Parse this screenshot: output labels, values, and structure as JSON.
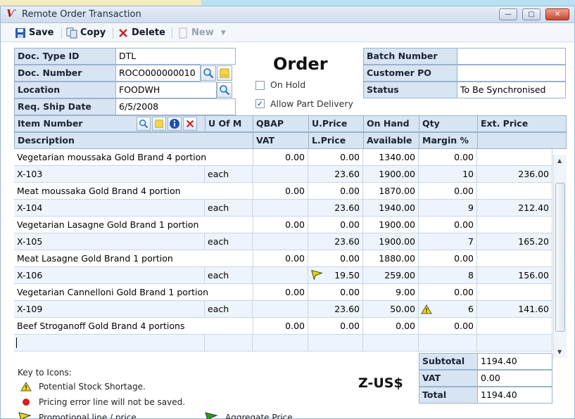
{
  "window": {
    "title": "Remote Order Transaction"
  },
  "toolbar": {
    "save": "Save",
    "copy": "Copy",
    "delete": "Delete",
    "new": "New"
  },
  "header": {
    "doc_type_id_label": "Doc. Type ID",
    "doc_type_id": "DTL",
    "doc_number_label": "Doc. Number",
    "doc_number": "ROCO000000010",
    "location_label": "Location",
    "location": "FOODWH",
    "req_ship_date_label": "Req. Ship Date",
    "req_ship_date": "6/5/2008",
    "order_title": "Order",
    "on_hold_label": "On Hold",
    "on_hold": false,
    "allow_part_label": "Allow Part Delivery",
    "allow_part": true,
    "batch_number_label": "Batch Number",
    "batch_number": "",
    "customer_po_label": "Customer PO",
    "customer_po": "",
    "status_label": "Status",
    "status": "To Be Synchronised"
  },
  "grid": {
    "head1": {
      "item_number": "Item Number",
      "uofm": "U Of M",
      "qbap": "QBAP",
      "uprice": "U.Price",
      "onhand": "On Hand",
      "qty": "Qty",
      "ext": "Ext. Price"
    },
    "head2": {
      "description": "Description",
      "vat": "VAT",
      "lprice": "L.Price",
      "available": "Available",
      "margin": "Margin %"
    },
    "items": [
      {
        "description": "Vegetarian moussaka  Gold Brand 4 portion",
        "qbap": "0.00",
        "uprice": "0.00",
        "onhand": "1340.00",
        "margin": "0.00",
        "item_number": "X-103",
        "uofm": "each",
        "lprice": "23.60",
        "available": "1900.00",
        "qty": "10",
        "ext": "236.00",
        "flag": "",
        "warn": false
      },
      {
        "description": "Meat moussaka   Gold Brand 4 portion",
        "qbap": "0.00",
        "uprice": "0.00",
        "onhand": "1870.00",
        "margin": "0.00",
        "item_number": "X-104",
        "uofm": "each",
        "lprice": "23.60",
        "available": "1940.00",
        "qty": "9",
        "ext": "212.40",
        "flag": "",
        "warn": false
      },
      {
        "description": "Vegetarian Lasagne  Gold Brand  1 portion",
        "qbap": "0.00",
        "uprice": "0.00",
        "onhand": "1900.00",
        "margin": "0.00",
        "item_number": "X-105",
        "uofm": "each",
        "lprice": "23.60",
        "available": "1900.00",
        "qty": "7",
        "ext": "165.20",
        "flag": "",
        "warn": false
      },
      {
        "description": "Meat  Lasagne  Gold Brand  1 portion",
        "qbap": "0.00",
        "uprice": "0.00",
        "onhand": "1880.00",
        "margin": "0.00",
        "item_number": "X-106",
        "uofm": "each",
        "lprice": "19.50",
        "available": "259.00",
        "qty": "8",
        "ext": "156.00",
        "flag": "promo",
        "warn": false
      },
      {
        "description": "Vegetarian Cannelloni  Gold Brand  1 portion",
        "qbap": "0.00",
        "uprice": "0.00",
        "onhand": "9.00",
        "margin": "0.00",
        "item_number": "X-109",
        "uofm": "each",
        "lprice": "23.60",
        "available": "50.00",
        "qty": "6",
        "ext": "141.60",
        "flag": "",
        "warn": true
      }
    ],
    "last": {
      "description": "Beef Stroganoff Gold Brand  4 portions",
      "qbap": "0.00",
      "uprice": "0.00",
      "onhand": "0.00",
      "margin": "0.00"
    }
  },
  "key": {
    "title": "Key to Icons:",
    "stock": "Potential Stock Shortage.",
    "pricing": "Pricing error  line will not be saved.",
    "promo": "Promotional line / price.",
    "aggregate": "Aggregate Price"
  },
  "totals": {
    "currency": "Z-US$",
    "subtotal_label": "Subtotal",
    "subtotal": "1194.40",
    "vat_label": "VAT",
    "vat": "0.00",
    "total_label": "Total",
    "total": "1194.40"
  },
  "colors": {
    "header_bg": "#d7e4f2",
    "alt_row": "#eef4fb",
    "promo_flag": "#e4d800",
    "aggregate_flag": "#1aa51a",
    "warn": "#f2d600",
    "error": "#d81b1b"
  }
}
